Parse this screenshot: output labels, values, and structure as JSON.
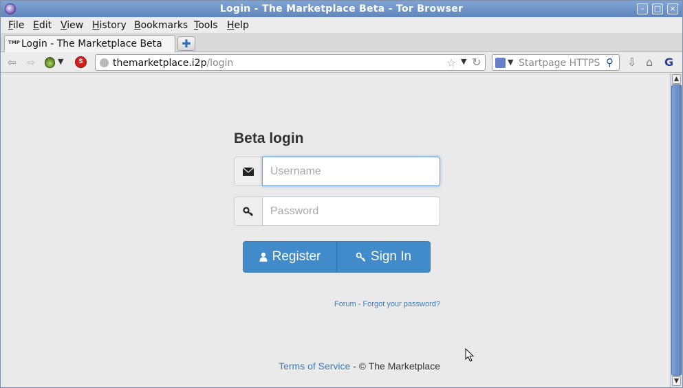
{
  "window": {
    "title": "Login - The Marketplace Beta - Tor Browser",
    "minimize": "–",
    "maximize": "□",
    "close": "×"
  },
  "menubar": {
    "items": [
      "File",
      "Edit",
      "View",
      "History",
      "Bookmarks",
      "Tools",
      "Help"
    ],
    "underline": [
      "F",
      "E",
      "V",
      "H",
      "B",
      "T",
      "H"
    ]
  },
  "tabs": [
    {
      "label": "Login - The Marketplace Beta",
      "favicon_text": "TMP"
    }
  ],
  "new_tab_label": "✚",
  "navbar": {
    "url_host": "themarketplace.i2p",
    "url_path": "/login",
    "search_placeholder": "Startpage HTTPS",
    "noscript_label": "S"
  },
  "page": {
    "heading": "Beta login",
    "username_placeholder": "Username",
    "password_placeholder": "Password",
    "register_label": "Register",
    "signin_label": "Sign In",
    "forum_link": "Forum",
    "forgot_link": "Forgot your password?",
    "links_separator": " - ",
    "terms_link": "Terms of Service",
    "copyright": " - © The Marketplace"
  },
  "icons": {
    "username_addon": "envelope-icon",
    "password_addon": "key-icon",
    "register": "user-icon",
    "signin": "key-icon"
  },
  "colors": {
    "primary_button": "#428bca",
    "link": "#3a7cc1",
    "titlebar": "#6f94c8"
  }
}
